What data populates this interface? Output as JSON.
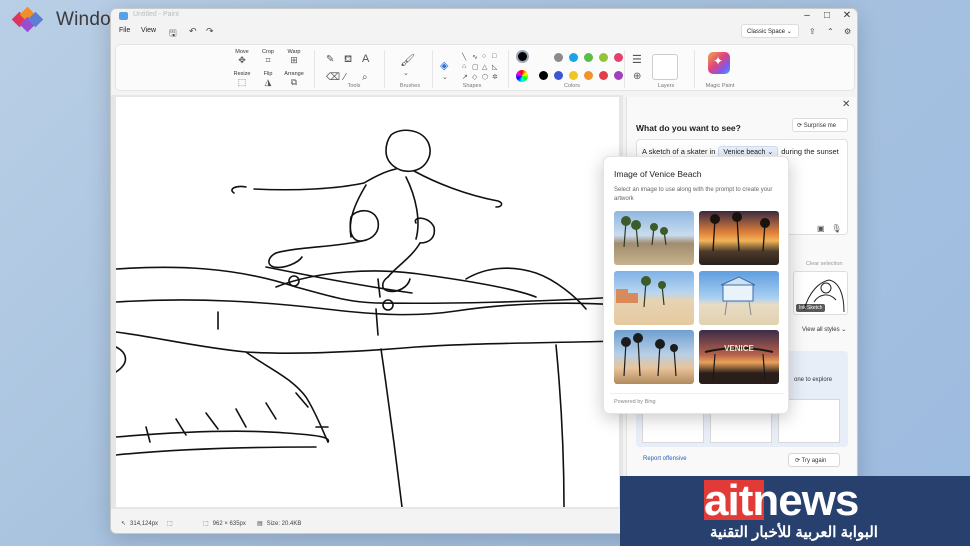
{
  "watermark": {
    "brand": "Windows Central",
    "logo_colors": [
      "#e0345c",
      "#f08e2a",
      "#5b7fd6",
      "#9b4dd0"
    ]
  },
  "window": {
    "title": "Untitled - Paint",
    "controls": {
      "minimize": "–",
      "maximize": "□",
      "close": "✕"
    }
  },
  "menu": {
    "file": "File",
    "view": "View",
    "save_icon": "save-icon",
    "undo_icon": "undo-icon",
    "redo_icon": "redo-icon",
    "space_select": "Classic Space",
    "settings_icon": "gear-icon"
  },
  "ribbon": {
    "image": {
      "move": "Move",
      "crop": "Crop",
      "warp": "Warp",
      "resize": "Resize",
      "flip": "Flip",
      "arrange": "Arrange"
    },
    "tools_label": "Tools",
    "brushes_label": "Brushes",
    "shapes_label": "Shapes",
    "colors_label": "Colors",
    "layers_label": "Layers",
    "magic_label": "Magic Paint",
    "colors": {
      "row1": [
        "#8a8a8a",
        "#1aa3e8",
        "#5bbd4a",
        "#91c43b",
        "#e83f6f"
      ],
      "row2": [
        "#000000",
        "#3b57d6",
        "#f2c61f",
        "#f0932a",
        "#e23d4b",
        "#a23fbe"
      ],
      "primary": "#000000"
    }
  },
  "canvas": {
    "scene": "Line sketch of a skater jumping over a skatepark bowl"
  },
  "statusbar": {
    "cursor_pos": "314,124px",
    "canvas_size": "962 × 635px",
    "file_size": "Size: 20.4KB"
  },
  "panel": {
    "heading": "What do you want to see?",
    "surprise": "Surprise me",
    "prompt_start": "A sketch of a skater in",
    "prompt_chip": "Venice beach",
    "prompt_chip_caret": "⌄",
    "prompt_end": "during the sunset",
    "clear_selection": "Clear selection",
    "style_label": "Ink Sketch",
    "view_all": "View all styles",
    "info_text": "one to explore",
    "report": "Report offensive",
    "try_again": "Try again"
  },
  "popup": {
    "title": "Image of Venice Beach",
    "subtitle": "Select an image to use along with the prompt to create your artwork",
    "footer": "Powered by Bing",
    "images": [
      {
        "name": "beach-path-palms"
      },
      {
        "name": "sunset-boardwalk"
      },
      {
        "name": "beach-sand-day"
      },
      {
        "name": "lifeguard-tower"
      },
      {
        "name": "palms-dusk"
      },
      {
        "name": "venice-sign-night",
        "sign_text": "VENICE"
      }
    ]
  },
  "aitnews": {
    "brand": "aitnews",
    "tagline": "البوابة العربية للأخبار التقنية"
  }
}
